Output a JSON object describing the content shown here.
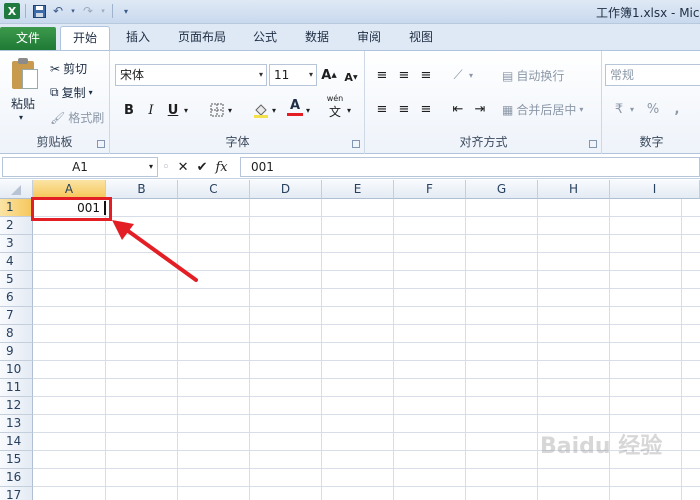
{
  "window": {
    "title": "工作簿1.xlsx  -  Mic",
    "qat": {
      "app_icon": "X"
    }
  },
  "tabs": [
    {
      "label": "文件"
    },
    {
      "label": "开始"
    },
    {
      "label": "插入"
    },
    {
      "label": "页面布局"
    },
    {
      "label": "公式"
    },
    {
      "label": "数据"
    },
    {
      "label": "审阅"
    },
    {
      "label": "视图"
    }
  ],
  "ribbon": {
    "clipboard": {
      "group_label": "剪贴板",
      "paste_label": "粘贴",
      "cut_label": "剪切",
      "copy_label": "复制",
      "format_painter_label": "格式刷"
    },
    "font": {
      "group_label": "字体",
      "font_name": "宋体",
      "font_size": "11",
      "grow": "A",
      "shrink": "A",
      "bold": "B",
      "italic": "I",
      "underline": "U",
      "font_color_letter": "A",
      "phonetic_label": "wén"
    },
    "alignment": {
      "group_label": "对齐方式",
      "wrap_label": "自动换行",
      "merge_label": "合并后居中"
    },
    "number": {
      "group_label": "数字",
      "format_value": "常规",
      "percent": "%",
      "comma": ","
    }
  },
  "formula_bar": {
    "name_box": "A1",
    "cancel": "✕",
    "enter": "✔",
    "fx": "fx",
    "content": "001"
  },
  "sheet": {
    "columns": [
      "A",
      "B",
      "C",
      "D",
      "E",
      "F",
      "G",
      "H",
      "I"
    ],
    "rows": [
      "1",
      "2",
      "3",
      "4",
      "5",
      "6",
      "7",
      "8",
      "9",
      "10",
      "11",
      "12",
      "13",
      "14",
      "15",
      "16",
      "17"
    ],
    "active_cell_value": "001"
  },
  "watermark": "Baidu 经验"
}
